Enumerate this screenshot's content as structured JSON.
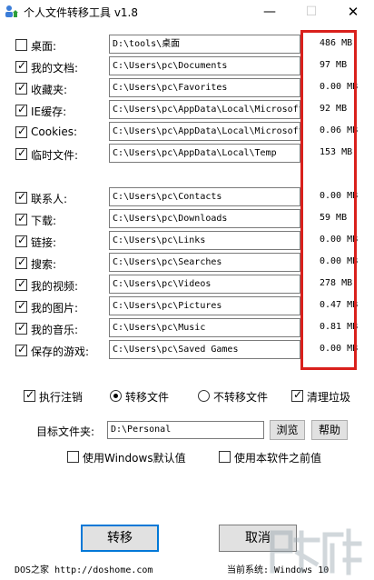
{
  "window": {
    "title": "个人文件转移工具 v1.8",
    "minimize_glyph": "—",
    "maximize_glyph": "☐",
    "close_glyph": "✕"
  },
  "folders": [
    {
      "label": "桌面:",
      "path": "D:\\tools\\桌面",
      "size": "486 MB",
      "checked": false
    },
    {
      "label": "我的文档:",
      "path": "C:\\Users\\pc\\Documents",
      "size": "97 MB",
      "checked": true
    },
    {
      "label": "收藏夹:",
      "path": "C:\\Users\\pc\\Favorites",
      "size": "0.00 MB",
      "checked": true
    },
    {
      "label": "IE缓存:",
      "path": "C:\\Users\\pc\\AppData\\Local\\Microsoft\\",
      "size": "92 MB",
      "checked": true
    },
    {
      "label": "Cookies:",
      "path": "C:\\Users\\pc\\AppData\\Local\\Microsoft\\",
      "size": "0.06 MB",
      "checked": true
    },
    {
      "label": "临时文件:",
      "path": "C:\\Users\\pc\\AppData\\Local\\Temp",
      "size": "153 MB",
      "checked": true
    },
    {
      "label": "联系人:",
      "path": "C:\\Users\\pc\\Contacts",
      "size": "0.00 MB",
      "checked": true
    },
    {
      "label": "下载:",
      "path": "C:\\Users\\pc\\Downloads",
      "size": "59 MB",
      "checked": true
    },
    {
      "label": "链接:",
      "path": "C:\\Users\\pc\\Links",
      "size": "0.00 MB",
      "checked": true
    },
    {
      "label": "搜索:",
      "path": "C:\\Users\\pc\\Searches",
      "size": "0.00 MB",
      "checked": true
    },
    {
      "label": "我的视频:",
      "path": "C:\\Users\\pc\\Videos",
      "size": "278 MB",
      "checked": true
    },
    {
      "label": "我的图片:",
      "path": "C:\\Users\\pc\\Pictures",
      "size": "0.47 MB",
      "checked": true
    },
    {
      "label": "我的音乐:",
      "path": "C:\\Users\\pc\\Music",
      "size": "0.81 MB",
      "checked": true
    },
    {
      "label": "保存的游戏:",
      "path": "C:\\Users\\pc\\Saved Games",
      "size": "0.00 MB",
      "checked": true
    }
  ],
  "options": {
    "logoff": {
      "label": "执行注销",
      "checked": true
    },
    "mode_transfer": {
      "label": "转移文件",
      "selected": true
    },
    "mode_no_transfer": {
      "label": "不转移文件",
      "selected": false
    },
    "clean": {
      "label": "清理垃圾",
      "checked": true
    }
  },
  "target": {
    "label": "目标文件夹:",
    "value": "D:\\Personal",
    "browse_label": "浏览",
    "help_label": "帮助"
  },
  "defaults": {
    "windows_default": {
      "label": "使用Windows默认值",
      "checked": false
    },
    "previous_value": {
      "label": "使用本软件之前值",
      "checked": false
    }
  },
  "actions": {
    "transfer_label": "转移",
    "cancel_label": "取消"
  },
  "footer": {
    "left": "DOS之家 http://doshome.com",
    "right": "当前系统: Windows 10"
  },
  "colors": {
    "highlight": "#d9201c",
    "focus_border": "#0078d7"
  }
}
